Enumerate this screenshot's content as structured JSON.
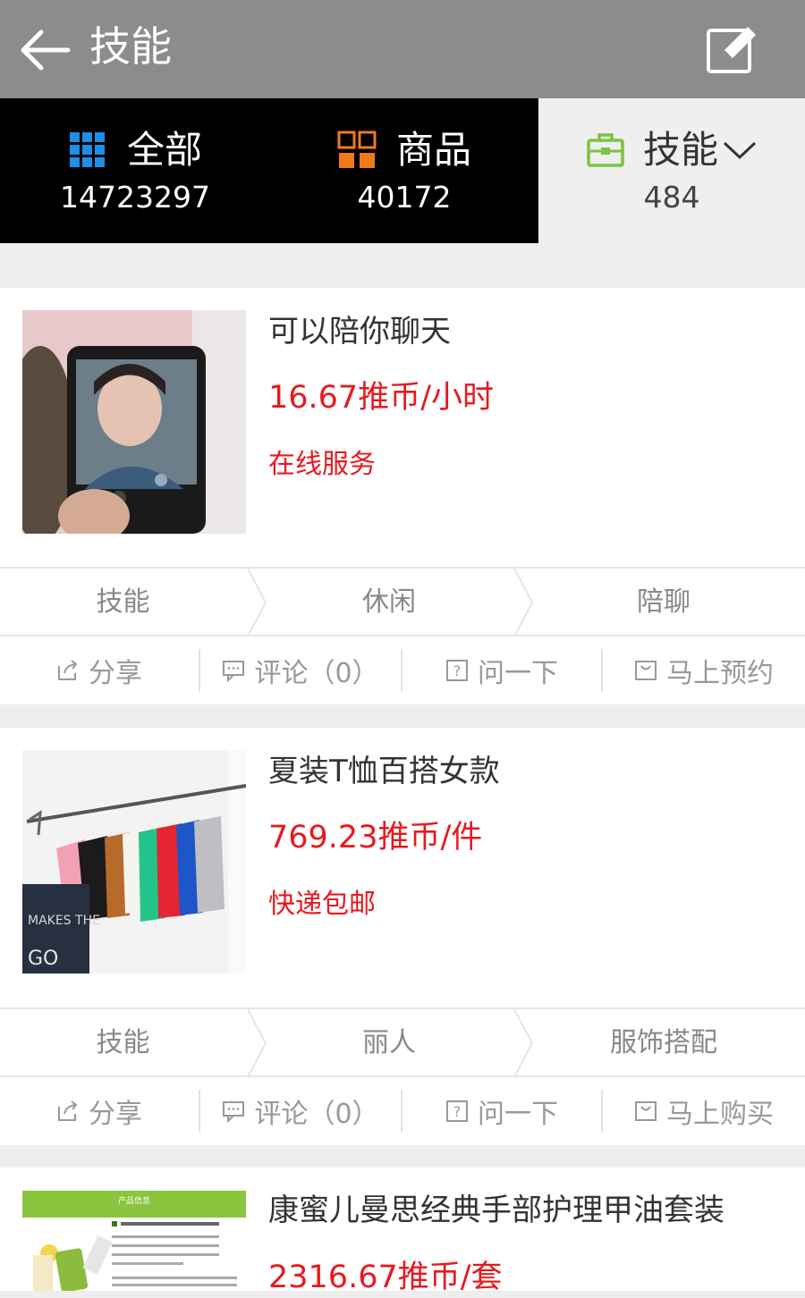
{
  "header": {
    "title": "技能"
  },
  "tabs": [
    {
      "label": "全部",
      "count": "14723297"
    },
    {
      "label": "商品",
      "count": "40172"
    },
    {
      "label": "技能",
      "count": "484"
    }
  ],
  "items": [
    {
      "title": "可以陪你聊天",
      "price": "16.67推币/小时",
      "service": "在线服务",
      "tags": [
        "技能",
        "休闲",
        "陪聊"
      ],
      "actions": {
        "share": "分享",
        "comment": "评论（0）",
        "ask": "问一下",
        "cta": "马上预约"
      }
    },
    {
      "title": "夏装T恤百搭女款",
      "price": "769.23推币/件",
      "service": "快递包邮",
      "tags": [
        "技能",
        "丽人",
        "服饰搭配"
      ],
      "actions": {
        "share": "分享",
        "comment": "评论（0）",
        "ask": "问一下",
        "cta": "马上购买"
      }
    },
    {
      "title": "康蜜儿曼思经典手部护理甲油套装",
      "price": "2316.67推币/套",
      "thumb_text": "产品信息"
    }
  ],
  "colors": {
    "header_bg": "#8c8c8c",
    "price_red": "#e8191e",
    "tab_active_bg": "#000000",
    "skill_green": "#7dc243",
    "goods_orange": "#f07a1a",
    "all_blue": "#1e8ee8"
  }
}
